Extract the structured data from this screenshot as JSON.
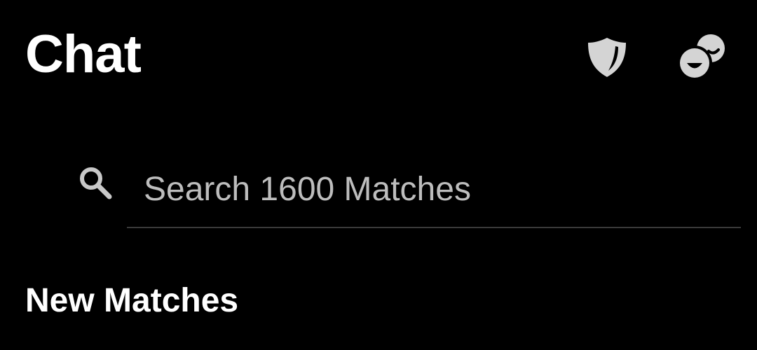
{
  "header": {
    "title": "Chat",
    "actions": [
      {
        "icon": "shield-icon",
        "color": "#d4d4d4"
      },
      {
        "icon": "emoji-faces-icon",
        "color": "#d4d4d4"
      }
    ]
  },
  "search": {
    "placeholder": "Search 1600 Matches",
    "value": "",
    "icon": "search-icon",
    "icon_color": "#c8c8c8"
  },
  "sections": {
    "new_matches_title": "New Matches"
  },
  "colors": {
    "background": "#000000",
    "text": "#ffffff",
    "placeholder": "#bdbdbd",
    "divider": "#3a3a3a"
  }
}
